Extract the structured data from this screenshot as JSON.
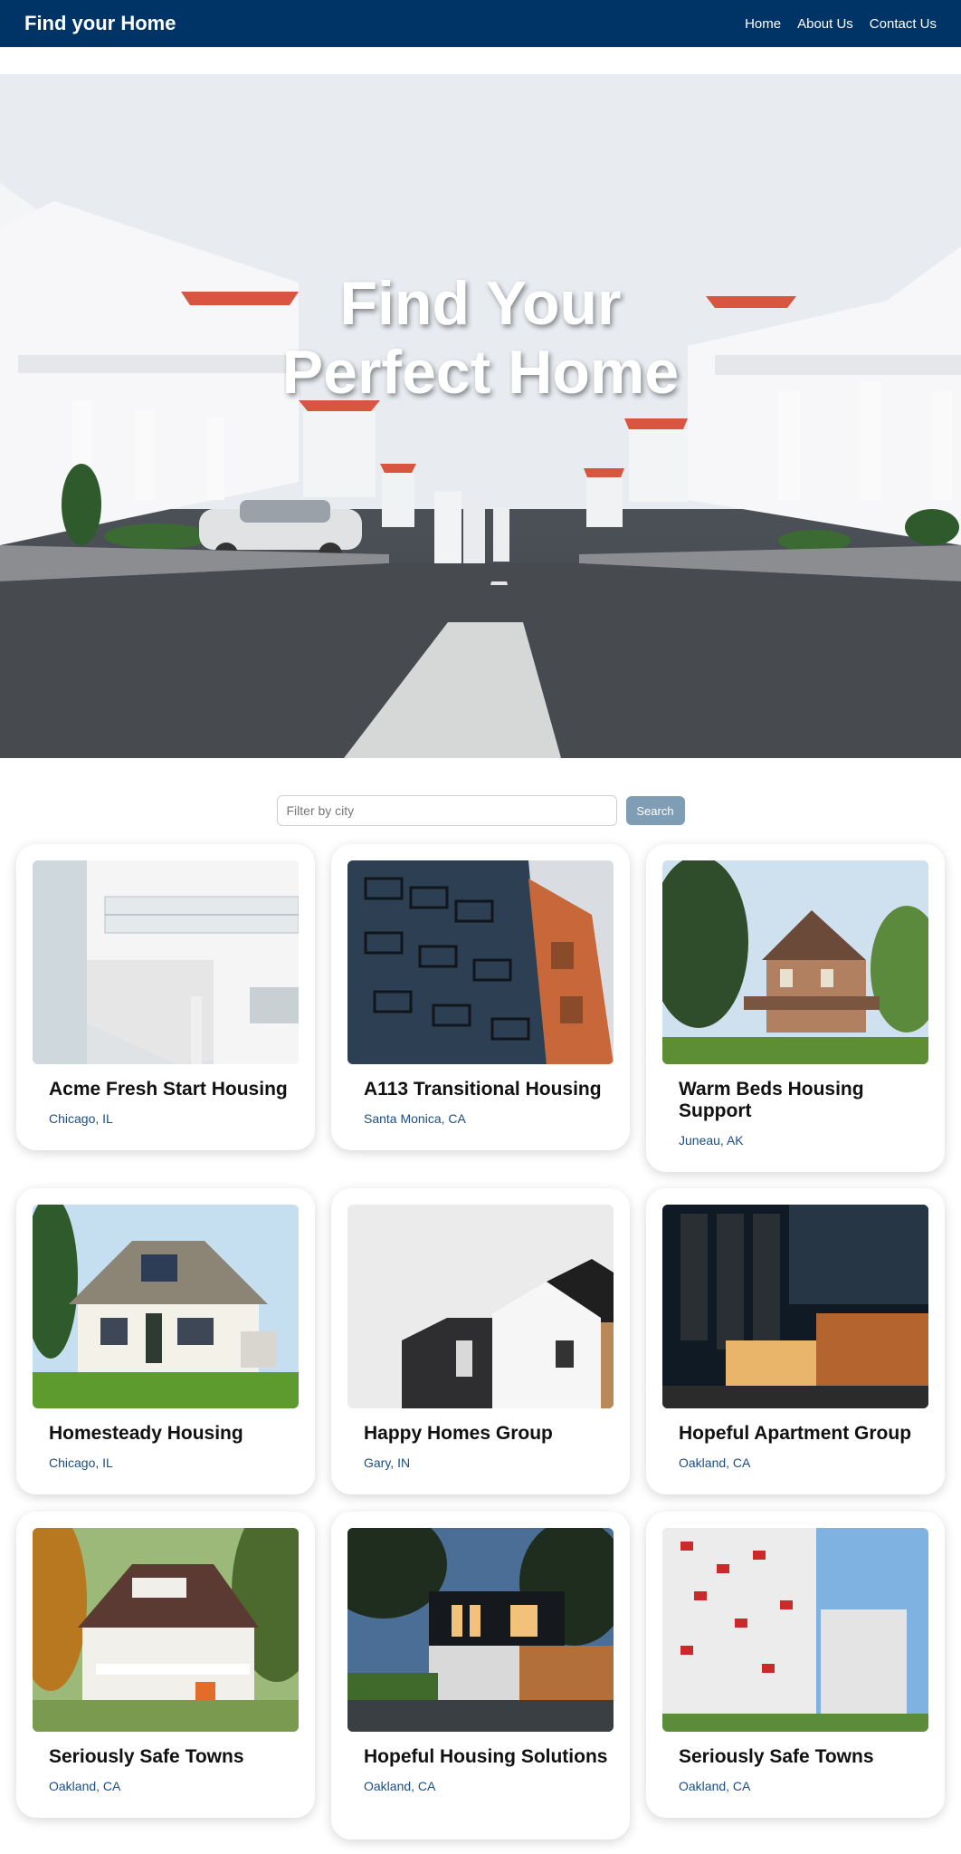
{
  "header": {
    "brand": "Find your Home",
    "nav": [
      "Home",
      "About Us",
      "Contact Us"
    ]
  },
  "hero": {
    "title_line1": "Find Your",
    "title_line2": "Perfect Home"
  },
  "search": {
    "placeholder": "Filter by city",
    "button_label": "Search"
  },
  "listings": [
    {
      "name": "Acme Fresh Start Housing",
      "city": "Chicago, IL"
    },
    {
      "name": "A113 Transitional Housing",
      "city": "Santa Monica, CA"
    },
    {
      "name": "Warm Beds Housing Support",
      "city": "Juneau, AK"
    },
    {
      "name": "Homesteady Housing",
      "city": "Chicago, IL"
    },
    {
      "name": "Happy Homes Group",
      "city": "Gary, IN"
    },
    {
      "name": "Hopeful Apartment Group",
      "city": "Oakland, CA"
    },
    {
      "name": "Seriously Safe Towns",
      "city": "Oakland, CA"
    },
    {
      "name": "Hopeful Housing Solutions",
      "city": "Oakland, CA"
    },
    {
      "name": "Seriously Safe Towns",
      "city": "Oakland, CA"
    }
  ],
  "colors": {
    "header_bg": "#003366",
    "search_button": "#7f9db5",
    "city_text": "#1a4e84"
  }
}
